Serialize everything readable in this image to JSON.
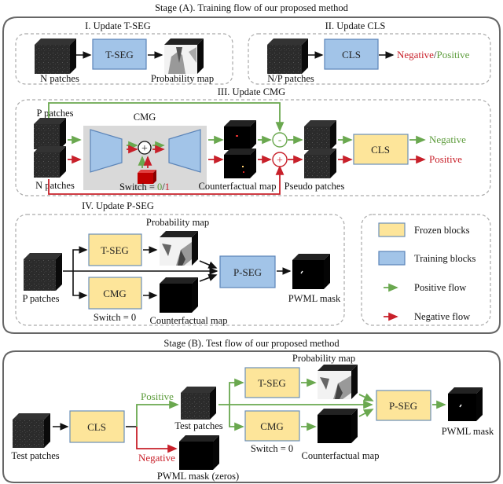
{
  "stage_a": {
    "title": "Stage (A). Training flow of our proposed method",
    "section1": {
      "title": "I. Update T-SEG",
      "input_label": "N patches",
      "block": "T-SEG",
      "output_label": "Probability map"
    },
    "section2": {
      "title": "II. Update CLS",
      "input_label": "N/P patches",
      "block": "CLS",
      "output_negative": "Negative",
      "output_slash": "/",
      "output_positive": "Positive"
    },
    "section3": {
      "title": "III. Update CMG",
      "p_label": "P patches",
      "n_label": "N patches",
      "cmg_label": "CMG",
      "switch_prefix": "Switch = ",
      "switch_zero": "0",
      "switch_slash": "/",
      "switch_one": "1",
      "cf_label": "Counterfactual map",
      "minus_symbol": "-",
      "plus_symbol": "+",
      "pseudo_label": "Pseudo patches",
      "cls_block": "CLS",
      "out_negative": "Negative",
      "out_positive": "Positive"
    },
    "section4": {
      "title": "IV. Update P-SEG",
      "input_label": "P patches",
      "tseg_block": "T-SEG",
      "cmg_block": "CMG",
      "switch_label": "Switch = 0",
      "prob_label": "Probability map",
      "cf_label": "Counterfactual map",
      "pseg_block": "P-SEG",
      "output_label": "PWML mask"
    },
    "legend": [
      {
        "label": "Frozen blocks",
        "kind": "frozen",
        "color": "#fde59a"
      },
      {
        "label": "Training blocks",
        "kind": "training",
        "color": "#a2c4e8"
      },
      {
        "label": "Positive flow",
        "kind": "arrow",
        "color": "#6aa84f"
      },
      {
        "label": "Negative flow",
        "kind": "arrow",
        "color": "#c8202a"
      }
    ]
  },
  "stage_b": {
    "title": "Stage (B). Test flow of our proposed method",
    "input_label": "Test patches",
    "cls_block": "CLS",
    "positive_label": "Positive",
    "negative_label": "Negative",
    "test_patches_label": "Test patches",
    "zeros_label": "PWML mask (zeros)",
    "tseg_block": "T-SEG",
    "cmg_block": "CMG",
    "switch_label": "Switch = 0",
    "prob_label": "Probability map",
    "cf_label": "Counterfactual map",
    "pseg_block": "P-SEG",
    "output_label": "PWML mask"
  },
  "colors": {
    "positive": "#6aa84f",
    "negative": "#c8202a",
    "frozen": "#fde59a",
    "training": "#a2c4e8"
  }
}
